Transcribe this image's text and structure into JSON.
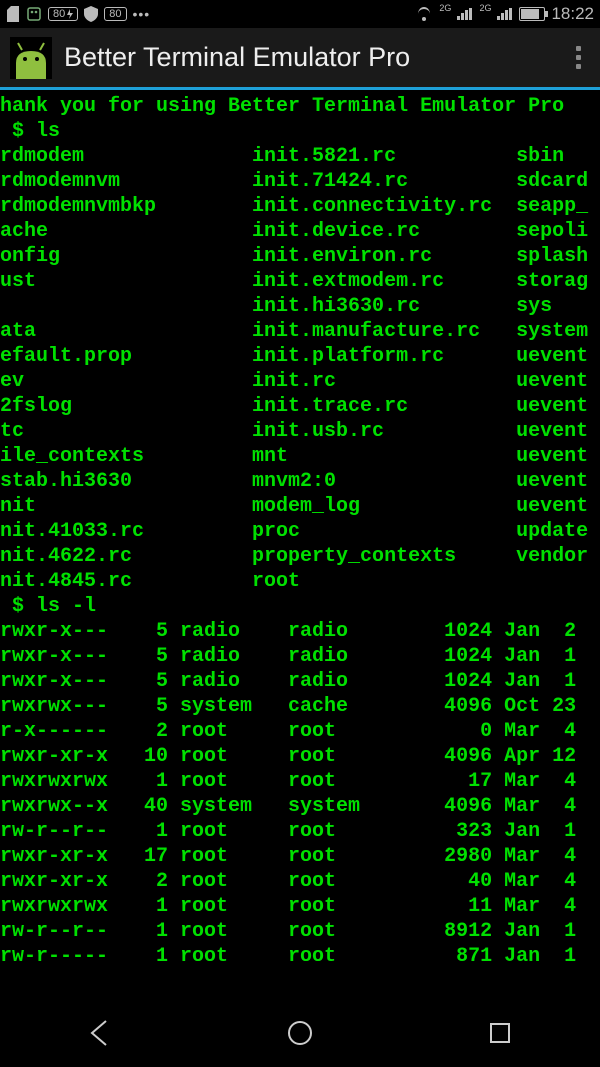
{
  "status": {
    "battery_pct_small": "80",
    "network_label": "2G",
    "clock": "18:22"
  },
  "app": {
    "title": "Better Terminal Emulator Pro"
  },
  "terminal": {
    "banner": "hank you for using Better Terminal Emulator Pro",
    "prompt1": " $ ls",
    "ls_columns": {
      "col1": [
        "rdmodem",
        "rdmodemnvm",
        "rdmodemnvmbkp",
        "ache",
        "onfig",
        "ust",
        "",
        "ata",
        "efault.prop",
        "ev",
        "2fslog",
        "tc",
        "ile_contexts",
        "stab.hi3630",
        "nit",
        "nit.41033.rc",
        "nit.4622.rc",
        "nit.4845.rc"
      ],
      "col2": [
        "init.5821.rc",
        "init.71424.rc",
        "init.connectivity.rc",
        "init.device.rc",
        "init.environ.rc",
        "init.extmodem.rc",
        "init.hi3630.rc",
        "init.manufacture.rc",
        "init.platform.rc",
        "init.rc",
        "init.trace.rc",
        "init.usb.rc",
        "mnt",
        "mnvm2:0",
        "modem_log",
        "proc",
        "property_contexts",
        "root"
      ],
      "col3": [
        "sbin",
        "sdcard",
        "seapp_",
        "sepoli",
        "splash",
        "storag",
        "sys",
        "system",
        "uevent",
        "uevent",
        "uevent",
        "uevent",
        "uevent",
        "uevent",
        "uevent",
        "update",
        "vendor",
        ""
      ]
    },
    "prompt2": " $ ls -l",
    "lsl": [
      {
        "perm": "rwxr-x---",
        "n": "5",
        "owner": "radio",
        "group": "radio",
        "size": "1024",
        "mon": "Jan",
        "day": "2"
      },
      {
        "perm": "rwxr-x---",
        "n": "5",
        "owner": "radio",
        "group": "radio",
        "size": "1024",
        "mon": "Jan",
        "day": "1"
      },
      {
        "perm": "rwxr-x---",
        "n": "5",
        "owner": "radio",
        "group": "radio",
        "size": "1024",
        "mon": "Jan",
        "day": "1"
      },
      {
        "perm": "rwxrwx---",
        "n": "5",
        "owner": "system",
        "group": "cache",
        "size": "4096",
        "mon": "Oct",
        "day": "23"
      },
      {
        "perm": "r-x------",
        "n": "2",
        "owner": "root",
        "group": "root",
        "size": "0",
        "mon": "Mar",
        "day": "4"
      },
      {
        "perm": "rwxr-xr-x",
        "n": "10",
        "owner": "root",
        "group": "root",
        "size": "4096",
        "mon": "Apr",
        "day": "12"
      },
      {
        "perm": "rwxrwxrwx",
        "n": "1",
        "owner": "root",
        "group": "root",
        "size": "17",
        "mon": "Mar",
        "day": "4"
      },
      {
        "perm": "rwxrwx--x",
        "n": "40",
        "owner": "system",
        "group": "system",
        "size": "4096",
        "mon": "Mar",
        "day": "4"
      },
      {
        "perm": "rw-r--r--",
        "n": "1",
        "owner": "root",
        "group": "root",
        "size": "323",
        "mon": "Jan",
        "day": "1"
      },
      {
        "perm": "rwxr-xr-x",
        "n": "17",
        "owner": "root",
        "group": "root",
        "size": "2980",
        "mon": "Mar",
        "day": "4"
      },
      {
        "perm": "rwxr-xr-x",
        "n": "2",
        "owner": "root",
        "group": "root",
        "size": "40",
        "mon": "Mar",
        "day": "4"
      },
      {
        "perm": "rwxrwxrwx",
        "n": "1",
        "owner": "root",
        "group": "root",
        "size": "11",
        "mon": "Mar",
        "day": "4"
      },
      {
        "perm": "rw-r--r--",
        "n": "1",
        "owner": "root",
        "group": "root",
        "size": "8912",
        "mon": "Jan",
        "day": "1"
      },
      {
        "perm": "rw-r-----",
        "n": "1",
        "owner": "root",
        "group": "root",
        "size": "871",
        "mon": "Jan",
        "day": "1"
      }
    ]
  }
}
